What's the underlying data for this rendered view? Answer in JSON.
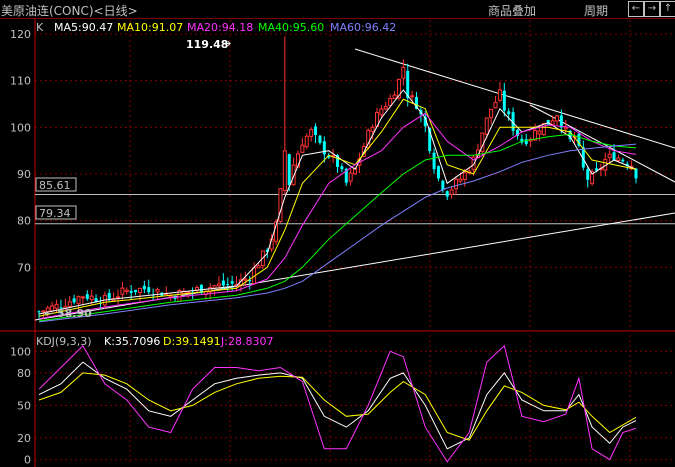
{
  "header": {
    "title": "美原油连(CONC)<日线>",
    "overlay_button": "商品叠加",
    "period_button": "周期",
    "nav_left": "←",
    "nav_right": "→",
    "nav_up": "↑"
  },
  "legend": {
    "k": "K",
    "ma5": "MA5:90.47",
    "ma10": "MA10:91.07",
    "ma20": "MA20:94.18",
    "ma40": "MA40:95.60",
    "ma60": "MA60:96.42"
  },
  "annotations": {
    "high": "119.48",
    "low": "58.90",
    "level1": "85.61",
    "level2": "79.34"
  },
  "indicator": {
    "name": "KDJ(9,3,3)",
    "k": "K:35.7096",
    "d": "D:39.1491",
    "j": "J:28.8307"
  },
  "colors": {
    "up": "#ff3333",
    "down": "#00ffff",
    "ma5": "#ffffff",
    "ma10": "#ffff00",
    "ma20": "#ff33ff",
    "ma40": "#00ff00",
    "ma60": "#8080ff",
    "grid": "#800000",
    "axis": "#c00000"
  },
  "chart_data": [
    {
      "type": "candlestick",
      "title": "美原油连(CONC)<日线>",
      "y_ticks": [
        70,
        80,
        90,
        100,
        110,
        120
      ],
      "ylim": [
        57,
        123
      ],
      "x_count": 120,
      "high_value": 119.48,
      "low_value": 58.9,
      "horizontal_levels": [
        85.61,
        79.34
      ],
      "close_path": [
        [
          0,
          60.5
        ],
        [
          5,
          62
        ],
        [
          10,
          64
        ],
        [
          15,
          63
        ],
        [
          20,
          65
        ],
        [
          25,
          65.5
        ],
        [
          30,
          64
        ],
        [
          35,
          65
        ],
        [
          40,
          66
        ],
        [
          45,
          66.5
        ],
        [
          48,
          68
        ],
        [
          50,
          71
        ],
        [
          52,
          74
        ],
        [
          54,
          79
        ],
        [
          55,
          86
        ],
        [
          56,
          95
        ],
        [
          57,
          88
        ],
        [
          58,
          92
        ],
        [
          60,
          97
        ],
        [
          62,
          99
        ],
        [
          64,
          96
        ],
        [
          66,
          94
        ],
        [
          68,
          92
        ],
        [
          70,
          88
        ],
        [
          72,
          91
        ],
        [
          74,
          96
        ],
        [
          76,
          101
        ],
        [
          78,
          104
        ],
        [
          80,
          106
        ],
        [
          82,
          110
        ],
        [
          83,
          113
        ],
        [
          84,
          107
        ],
        [
          86,
          105
        ],
        [
          88,
          100
        ],
        [
          89,
          96
        ],
        [
          90,
          92
        ],
        [
          91,
          89
        ],
        [
          93,
          86
        ],
        [
          95,
          88
        ],
        [
          97,
          90
        ],
        [
          99,
          93
        ],
        [
          101,
          99
        ],
        [
          103,
          104
        ],
        [
          105,
          107
        ],
        [
          106,
          104
        ],
        [
          108,
          100
        ],
        [
          110,
          97
        ],
        [
          112,
          98
        ],
        [
          114,
          100
        ],
        [
          116,
          101
        ],
        [
          118,
          103
        ],
        [
          119,
          101
        ],
        [
          120,
          99
        ],
        [
          121,
          97
        ],
        [
          122,
          98
        ],
        [
          123,
          95
        ],
        [
          124,
          91
        ],
        [
          125,
          89
        ],
        [
          127,
          90
        ],
        [
          129,
          93
        ],
        [
          131,
          94
        ],
        [
          133,
          93
        ],
        [
          135,
          92
        ],
        [
          136,
          90
        ]
      ],
      "series": [
        {
          "name": "MA5",
          "values": [
            [
              0,
              60
            ],
            [
              15,
              63
            ],
            [
              30,
              64.5
            ],
            [
              45,
              66
            ],
            [
              52,
              73
            ],
            [
              56,
              85
            ],
            [
              60,
              94
            ],
            [
              66,
              95
            ],
            [
              72,
              91
            ],
            [
              78,
              102
            ],
            [
              83,
              108
            ],
            [
              88,
              102
            ],
            [
              93,
              88
            ],
            [
              99,
              92
            ],
            [
              105,
              104
            ],
            [
              110,
              99
            ],
            [
              116,
              101
            ],
            [
              121,
              98
            ],
            [
              126,
              90
            ],
            [
              131,
              93
            ],
            [
              136,
              91
            ]
          ]
        },
        {
          "name": "MA10",
          "values": [
            [
              0,
              59.5
            ],
            [
              15,
              62.5
            ],
            [
              30,
              64
            ],
            [
              45,
              65.5
            ],
            [
              52,
              70
            ],
            [
              56,
              78
            ],
            [
              60,
              88
            ],
            [
              66,
              94
            ],
            [
              72,
              92
            ],
            [
              78,
              99
            ],
            [
              83,
              106
            ],
            [
              88,
              104
            ],
            [
              93,
              92
            ],
            [
              99,
              90
            ],
            [
              105,
              100
            ],
            [
              110,
              100
            ],
            [
              116,
              100
            ],
            [
              121,
              99
            ],
            [
              126,
              93
            ],
            [
              131,
              92
            ],
            [
              136,
              91
            ]
          ]
        },
        {
          "name": "MA20",
          "values": [
            [
              0,
              59
            ],
            [
              15,
              61.5
            ],
            [
              30,
              63.5
            ],
            [
              45,
              65
            ],
            [
              52,
              67.5
            ],
            [
              56,
              72
            ],
            [
              60,
              79
            ],
            [
              66,
              88
            ],
            [
              72,
              92
            ],
            [
              78,
              95
            ],
            [
              83,
              100
            ],
            [
              88,
              103
            ],
            [
              93,
              97
            ],
            [
              99,
              93
            ],
            [
              105,
              96
            ],
            [
              110,
              99
            ],
            [
              116,
              100.5
            ],
            [
              121,
              100
            ],
            [
              126,
              97
            ],
            [
              131,
              95
            ],
            [
              136,
              94.2
            ]
          ]
        },
        {
          "name": "MA40",
          "values": [
            [
              0,
              58.5
            ],
            [
              15,
              60.5
            ],
            [
              30,
              62.5
            ],
            [
              45,
              64
            ],
            [
              52,
              65.5
            ],
            [
              56,
              67
            ],
            [
              60,
              70
            ],
            [
              66,
              76
            ],
            [
              72,
              81
            ],
            [
              78,
              86
            ],
            [
              83,
              90
            ],
            [
              88,
              93
            ],
            [
              93,
              94
            ],
            [
              99,
              94
            ],
            [
              105,
              95
            ],
            [
              110,
              97
            ],
            [
              116,
              98
            ],
            [
              121,
              98.5
            ],
            [
              126,
              97
            ],
            [
              131,
              96
            ],
            [
              136,
              95.6
            ]
          ]
        },
        {
          "name": "MA60",
          "values": [
            [
              0,
              58.3
            ],
            [
              15,
              60
            ],
            [
              30,
              62
            ],
            [
              45,
              63.5
            ],
            [
              52,
              64.5
            ],
            [
              56,
              65.5
            ],
            [
              60,
              67
            ],
            [
              66,
              71
            ],
            [
              72,
              75
            ],
            [
              78,
              79
            ],
            [
              83,
              82
            ],
            [
              88,
              85
            ],
            [
              93,
              87
            ],
            [
              99,
              88.5
            ],
            [
              105,
              90.5
            ],
            [
              110,
              92.5
            ],
            [
              116,
              94
            ],
            [
              121,
              95
            ],
            [
              126,
              95.5
            ],
            [
              131,
              96
            ],
            [
              136,
              96.4
            ]
          ]
        }
      ]
    },
    {
      "type": "line",
      "title": "KDJ(9,3,3)",
      "y_ticks": [
        0,
        20,
        50,
        80,
        100
      ],
      "ylim": [
        -5,
        115
      ],
      "series": [
        {
          "name": "K",
          "values": [
            [
              0,
              60
            ],
            [
              5,
              70
            ],
            [
              10,
              90
            ],
            [
              15,
              75
            ],
            [
              20,
              65
            ],
            [
              25,
              45
            ],
            [
              30,
              40
            ],
            [
              35,
              55
            ],
            [
              40,
              70
            ],
            [
              45,
              75
            ],
            [
              50,
              78
            ],
            [
              55,
              80
            ],
            [
              60,
              75
            ],
            [
              65,
              40
            ],
            [
              70,
              30
            ],
            [
              75,
              45
            ],
            [
              80,
              75
            ],
            [
              83,
              80
            ],
            [
              88,
              50
            ],
            [
              93,
              10
            ],
            [
              98,
              20
            ],
            [
              102,
              60
            ],
            [
              106,
              80
            ],
            [
              110,
              55
            ],
            [
              115,
              45
            ],
            [
              120,
              45
            ],
            [
              123,
              60
            ],
            [
              126,
              30
            ],
            [
              130,
              15
            ],
            [
              133,
              30
            ],
            [
              136,
              36
            ]
          ]
        },
        {
          "name": "D",
          "values": [
            [
              0,
              55
            ],
            [
              5,
              62
            ],
            [
              10,
              80
            ],
            [
              15,
              78
            ],
            [
              20,
              70
            ],
            [
              25,
              55
            ],
            [
              30,
              45
            ],
            [
              35,
              50
            ],
            [
              40,
              62
            ],
            [
              45,
              70
            ],
            [
              50,
              75
            ],
            [
              55,
              77
            ],
            [
              60,
              76
            ],
            [
              65,
              55
            ],
            [
              70,
              40
            ],
            [
              75,
              42
            ],
            [
              80,
              62
            ],
            [
              83,
              72
            ],
            [
              88,
              60
            ],
            [
              93,
              25
            ],
            [
              98,
              18
            ],
            [
              102,
              45
            ],
            [
              106,
              68
            ],
            [
              110,
              62
            ],
            [
              115,
              50
            ],
            [
              120,
              46
            ],
            [
              123,
              53
            ],
            [
              126,
              40
            ],
            [
              130,
              25
            ],
            [
              133,
              32
            ],
            [
              136,
              39
            ]
          ]
        },
        {
          "name": "J",
          "values": [
            [
              0,
              65
            ],
            [
              5,
              85
            ],
            [
              10,
              105
            ],
            [
              15,
              70
            ],
            [
              20,
              55
            ],
            [
              25,
              30
            ],
            [
              30,
              25
            ],
            [
              35,
              65
            ],
            [
              40,
              85
            ],
            [
              45,
              85
            ],
            [
              50,
              82
            ],
            [
              55,
              85
            ],
            [
              60,
              72
            ],
            [
              65,
              10
            ],
            [
              70,
              10
            ],
            [
              75,
              50
            ],
            [
              80,
              100
            ],
            [
              83,
              95
            ],
            [
              88,
              30
            ],
            [
              93,
              -2
            ],
            [
              98,
              25
            ],
            [
              102,
              90
            ],
            [
              106,
              105
            ],
            [
              110,
              40
            ],
            [
              115,
              35
            ],
            [
              120,
              42
            ],
            [
              123,
              75
            ],
            [
              126,
              10
            ],
            [
              130,
              0
            ],
            [
              133,
              25
            ],
            [
              136,
              29
            ]
          ]
        }
      ]
    }
  ]
}
